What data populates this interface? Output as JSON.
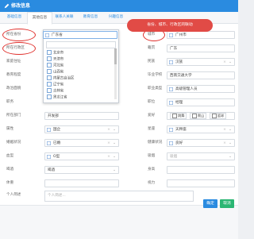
{
  "window": {
    "title": "修改信息"
  },
  "tabs": [
    "基础信息",
    "其他信息",
    "联系人关联",
    "教育信息",
    "兴趣信息"
  ],
  "active_tab_index": 1,
  "tooltip": "省份、城市、行政区的联动",
  "form": {
    "province": {
      "label": "所在省份",
      "value": "广东省"
    },
    "city": {
      "label": "城市",
      "value": "广州市"
    },
    "district": {
      "label": "所在行政区"
    },
    "native_place": {
      "label": "籍贯",
      "value": "广东"
    },
    "home_address": {
      "label": "家庭住址"
    },
    "nation": {
      "label": "民族",
      "value": "汉族"
    },
    "education": {
      "label": "教育程度"
    },
    "school": {
      "label": "毕业学校",
      "value": "西南交通大学"
    },
    "politics": {
      "label": "政治面貌"
    },
    "job_type": {
      "label": "职业类型",
      "value": "高级管理人员"
    },
    "position": {
      "label": "职务"
    },
    "title_post": {
      "label": "职位",
      "value": "经理"
    },
    "department": {
      "label": "所在部门",
      "value": "开发部"
    },
    "hobby": {
      "label": "爱好",
      "values": [
        "跳舞",
        "爬山",
        "篮球"
      ]
    },
    "attribute": {
      "label": "属性",
      "value": "国企"
    },
    "color": {
      "label": "星座",
      "value": "天秤座"
    },
    "marital": {
      "label": "婚姻状况",
      "value": "已婚"
    },
    "health": {
      "label": "健康状况",
      "value": "良好"
    },
    "blood": {
      "label": "血型",
      "value": "O型"
    },
    "smoke": {
      "label": "吸烟",
      "placeholder": "吸烟"
    },
    "drink": {
      "label": "喝酒",
      "value": "喝酒"
    },
    "height": {
      "label": "身高"
    },
    "weight": {
      "label": "体重"
    },
    "vision": {
      "label": "视力"
    },
    "intro": {
      "label": "个人简述",
      "placeholder": "个人简述..."
    }
  },
  "province_list": [
    "北京市",
    "天津市",
    "河北省",
    "山西省",
    "内蒙古自治区",
    "辽宁省",
    "吉林省",
    "黑龙江省"
  ],
  "buttons": {
    "ok": "确定",
    "cancel": "取消"
  },
  "colors": {
    "accent": "#2a8be0",
    "ok": "#2a8be0",
    "cancel": "#2bb673",
    "annotation": "#e0302c"
  }
}
